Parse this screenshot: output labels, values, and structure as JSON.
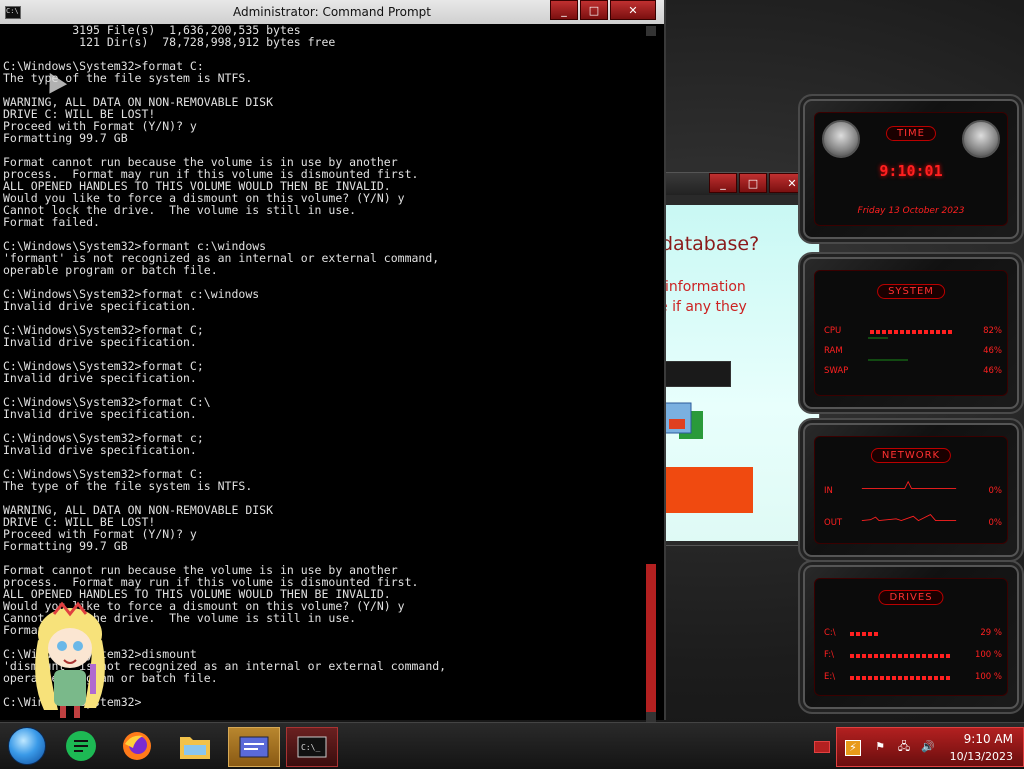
{
  "cmd_window": {
    "title": "Administrator: Command Prompt",
    "lines": [
      "          3195 File(s)  1,636,200,535 bytes",
      "           121 Dir(s)  78,728,998,912 bytes free",
      "",
      "C:\\Windows\\System32>format C:",
      "The type of the file system is NTFS.",
      "",
      "WARNING, ALL DATA ON NON-REMOVABLE DISK",
      "DRIVE C: WILL BE LOST!",
      "Proceed with Format (Y/N)? y",
      "Formatting 99.7 GB",
      "",
      "Format cannot run because the volume is in use by another",
      "process.  Format may run if this volume is dismounted first.",
      "ALL OPENED HANDLES TO THIS VOLUME WOULD THEN BE INVALID.",
      "Would you like to force a dismount on this volume? (Y/N) y",
      "Cannot lock the drive.  The volume is still in use.",
      "Format failed.",
      "",
      "C:\\Windows\\System32>formant c:\\windows",
      "'formant' is not recognized as an internal or external command,",
      "operable program or batch file.",
      "",
      "C:\\Windows\\System32>format c:\\windows",
      "Invalid drive specification.",
      "",
      "C:\\Windows\\System32>format C;",
      "Invalid drive specification.",
      "",
      "C:\\Windows\\System32>format C;",
      "Invalid drive specification.",
      "",
      "C:\\Windows\\System32>format C:\\",
      "Invalid drive specification.",
      "",
      "C:\\Windows\\System32>format c;",
      "Invalid drive specification.",
      "",
      "C:\\Windows\\System32>format C:",
      "The type of the file system is NTFS.",
      "",
      "WARNING, ALL DATA ON NON-REMOVABLE DISK",
      "DRIVE C: WILL BE LOST!",
      "Proceed with Format (Y/N)? y",
      "Formatting 99.7 GB",
      "",
      "Format cannot run because the volume is in use by another",
      "process.  Format may run if this volume is dismounted first.",
      "ALL OPENED HANDLES TO THIS VOLUME WOULD THEN BE INVALID.",
      "Would you like to force a dismount on this volume? (Y/N) y",
      "Cannot lock the drive.  The volume is still in use.",
      "Format failed.",
      "",
      "C:\\Windows\\System32>dismount",
      "'dismount' is not recognized as an internal or external command,",
      "operable program or batch file.",
      "",
      "C:\\Windows\\System32>"
    ]
  },
  "dialog": {
    "heading": "database?",
    "line1": "information",
    "line2": "e if any they"
  },
  "gadgets": {
    "time": {
      "title": "TIME",
      "clock": "9:10:01",
      "date": "Friday 13 October 2023"
    },
    "system": {
      "title": "SYSTEM",
      "rows": [
        {
          "label": "CPU",
          "value": "82%",
          "fraction": 0.82
        },
        {
          "label": "RAM",
          "value": "46%",
          "fraction": 0.46
        },
        {
          "label": "SWAP",
          "value": "46%",
          "fraction": 0.46
        }
      ]
    },
    "network": {
      "title": "NETWORK",
      "rows": [
        {
          "label": "IN",
          "value": "0%"
        },
        {
          "label": "OUT",
          "value": "0%"
        }
      ]
    },
    "drives": {
      "title": "DRIVES",
      "rows": [
        {
          "label": "C:\\",
          "value": "29 %",
          "fraction": 0.29
        },
        {
          "label": "F:\\",
          "value": "100 %",
          "fraction": 1.0
        },
        {
          "label": "E:\\",
          "value": "100 %",
          "fraction": 1.0
        }
      ]
    }
  },
  "taskbar": {
    "apps": [
      {
        "name": "start-button",
        "icon": "windows-orb-icon"
      },
      {
        "name": "notes-app",
        "icon": "green-lines-icon"
      },
      {
        "name": "firefox",
        "icon": "firefox-icon"
      },
      {
        "name": "file-explorer",
        "icon": "folder-icon"
      },
      {
        "name": "control-panel",
        "icon": "window-card-icon"
      },
      {
        "name": "command-prompt",
        "icon": "terminal-icon"
      }
    ],
    "tray": {
      "time": "9:10 AM",
      "date": "10/13/2023"
    }
  },
  "colors": {
    "accent": "#ff2020",
    "console_text": "#e0e0e0",
    "console_bg": "#000000",
    "dialog_heading": "#8b1a1a",
    "dialog_orange": "#f04a10"
  }
}
